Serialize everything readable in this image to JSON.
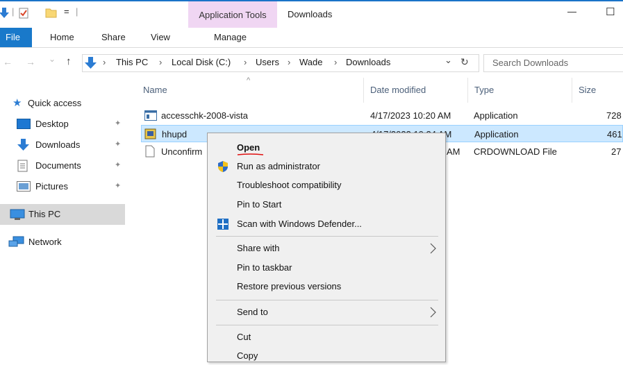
{
  "window": {
    "title": "Downloads",
    "context_tab_title": "Application Tools",
    "minimize_glyph": "—",
    "maximize_glyph": "☐"
  },
  "quick_toolbar": {
    "separator": "|",
    "dropdown": "="
  },
  "ribbon": {
    "tabs": [
      "File",
      "Home",
      "Share",
      "View",
      "Manage"
    ]
  },
  "address": {
    "back": "←",
    "forward": "→",
    "recent": "⌄",
    "up": "↑",
    "breadcrumb": [
      "This PC",
      "Local Disk (C:)",
      "Users",
      "Wade",
      "Downloads"
    ],
    "separator": "›",
    "dropdown": "⌄",
    "refresh": "↻",
    "search_placeholder": "Search Downloads"
  },
  "nav": {
    "items": [
      {
        "label": "Quick access",
        "icon": "star-icon",
        "pinned": false
      },
      {
        "label": "Desktop",
        "icon": "desktop-icon",
        "pinned": true
      },
      {
        "label": "Downloads",
        "icon": "download-arrow-icon",
        "pinned": true
      },
      {
        "label": "Documents",
        "icon": "documents-icon",
        "pinned": true
      },
      {
        "label": "Pictures",
        "icon": "pictures-icon",
        "pinned": true
      },
      {
        "label": "This PC",
        "icon": "computer-icon",
        "pinned": false,
        "selected": true
      },
      {
        "label": "Network",
        "icon": "network-icon",
        "pinned": false
      }
    ],
    "pin_glyph": "📌"
  },
  "columns": {
    "sort_glyph": "^",
    "headers": [
      "Name",
      "Date modified",
      "Type",
      "Size"
    ]
  },
  "files": [
    {
      "name": "accesschk-2008-vista",
      "date": "4/17/2023 10:20 AM",
      "type": "Application",
      "size": "728",
      "icon": "app-window-icon"
    },
    {
      "name": "hhupd",
      "date": "4/17/2023 10:24 AM",
      "type": "Application",
      "size": "461",
      "icon": "installer-icon",
      "selected": true
    },
    {
      "name": "Unconfirm",
      "date": "AM",
      "type": "CRDOWNLOAD File",
      "size": "27",
      "icon": "blank-file-icon"
    }
  ],
  "context_menu": {
    "groups": [
      [
        {
          "label": "Open",
          "bold": true
        },
        {
          "label": "Run as administrator",
          "icon": "uac-shield-icon"
        },
        {
          "label": "Troubleshoot compatibility"
        },
        {
          "label": "Pin to Start"
        },
        {
          "label": "Scan with Windows Defender...",
          "icon": "defender-icon"
        }
      ],
      [
        {
          "label": "Share with",
          "submenu": true
        },
        {
          "label": "Pin to taskbar"
        },
        {
          "label": "Restore previous versions"
        }
      ],
      [
        {
          "label": "Send to",
          "submenu": true
        }
      ],
      [
        {
          "label": "Cut"
        },
        {
          "label": "Copy"
        }
      ]
    ]
  },
  "colors": {
    "accent": "#1979ca",
    "selection": "#cce8ff",
    "context_tab": "#f0d6f3",
    "menu_bg": "#f0f0f0"
  }
}
